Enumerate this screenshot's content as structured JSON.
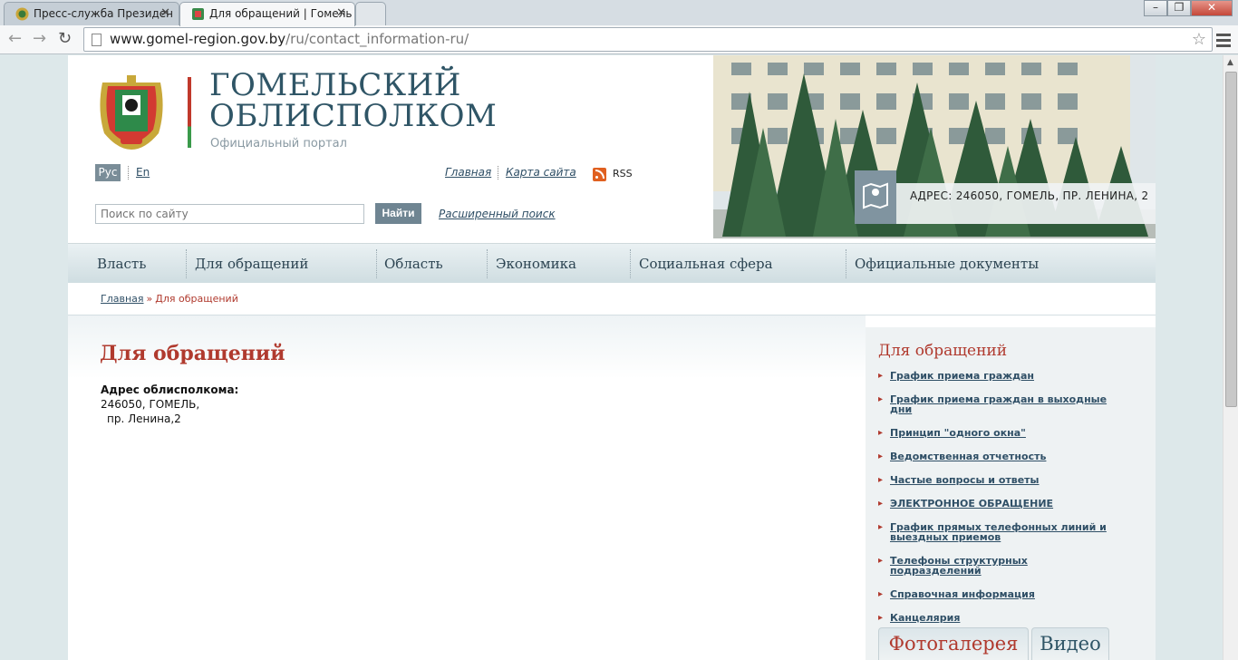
{
  "browser": {
    "tabs": [
      {
        "label": "Пресс-служба Президен"
      },
      {
        "label": "Для обращений | Гомель"
      }
    ],
    "url_host": "www.gomel-region.gov.by",
    "url_path": "/ru/contact_information-ru/"
  },
  "header": {
    "title_line1": "ГОМЕЛЬСКИЙ",
    "title_line2": "ОБЛИСПОЛКОМ",
    "subtitle": "Официальный портал",
    "lang_ru": "Рус",
    "lang_en": "En",
    "link_home": "Главная",
    "link_sitemap": "Карта сайта",
    "rss": "RSS",
    "search_placeholder": "Поиск по сайту",
    "search_button": "Найти",
    "advanced_search": "Расширенный поиск",
    "address_banner": "АДРЕС: 246050, ГОМЕЛЬ, ПР. ЛЕНИНА, 2"
  },
  "nav": {
    "items": [
      "Власть",
      "Для обращений",
      "Область",
      "Экономика",
      "Социальная сфера",
      "Официальные документы"
    ]
  },
  "breadcrumb": {
    "home": "Главная",
    "separator": "»",
    "current": "Для обращений"
  },
  "main": {
    "title": "Для обращений",
    "address_label": "Адрес облисполкома:",
    "address_line1": "246050, ГОМЕЛЬ,",
    "address_line2": "пр. Ленина,2"
  },
  "sidebar": {
    "title": "Для обращений",
    "items": [
      "График приема граждан",
      "График приема граждан в выходные дни",
      "Принцип \"одного окна\"",
      "Ведомственная отчетность",
      "Частые вопросы и ответы",
      "ЭЛЕКТРОННОЕ ОБРАЩЕНИЕ",
      "График прямых телефонных линий и выездных приемов",
      "Телефоны структурных подразделений",
      "Справочная информация",
      "Канцелярия"
    ],
    "gallery_tab": "Фотогалерея",
    "video_tab": "Видео"
  },
  "colors": {
    "accent_red": "#b03a2e",
    "title_blue": "#2f5566",
    "link_blue": "#2f4f66"
  }
}
